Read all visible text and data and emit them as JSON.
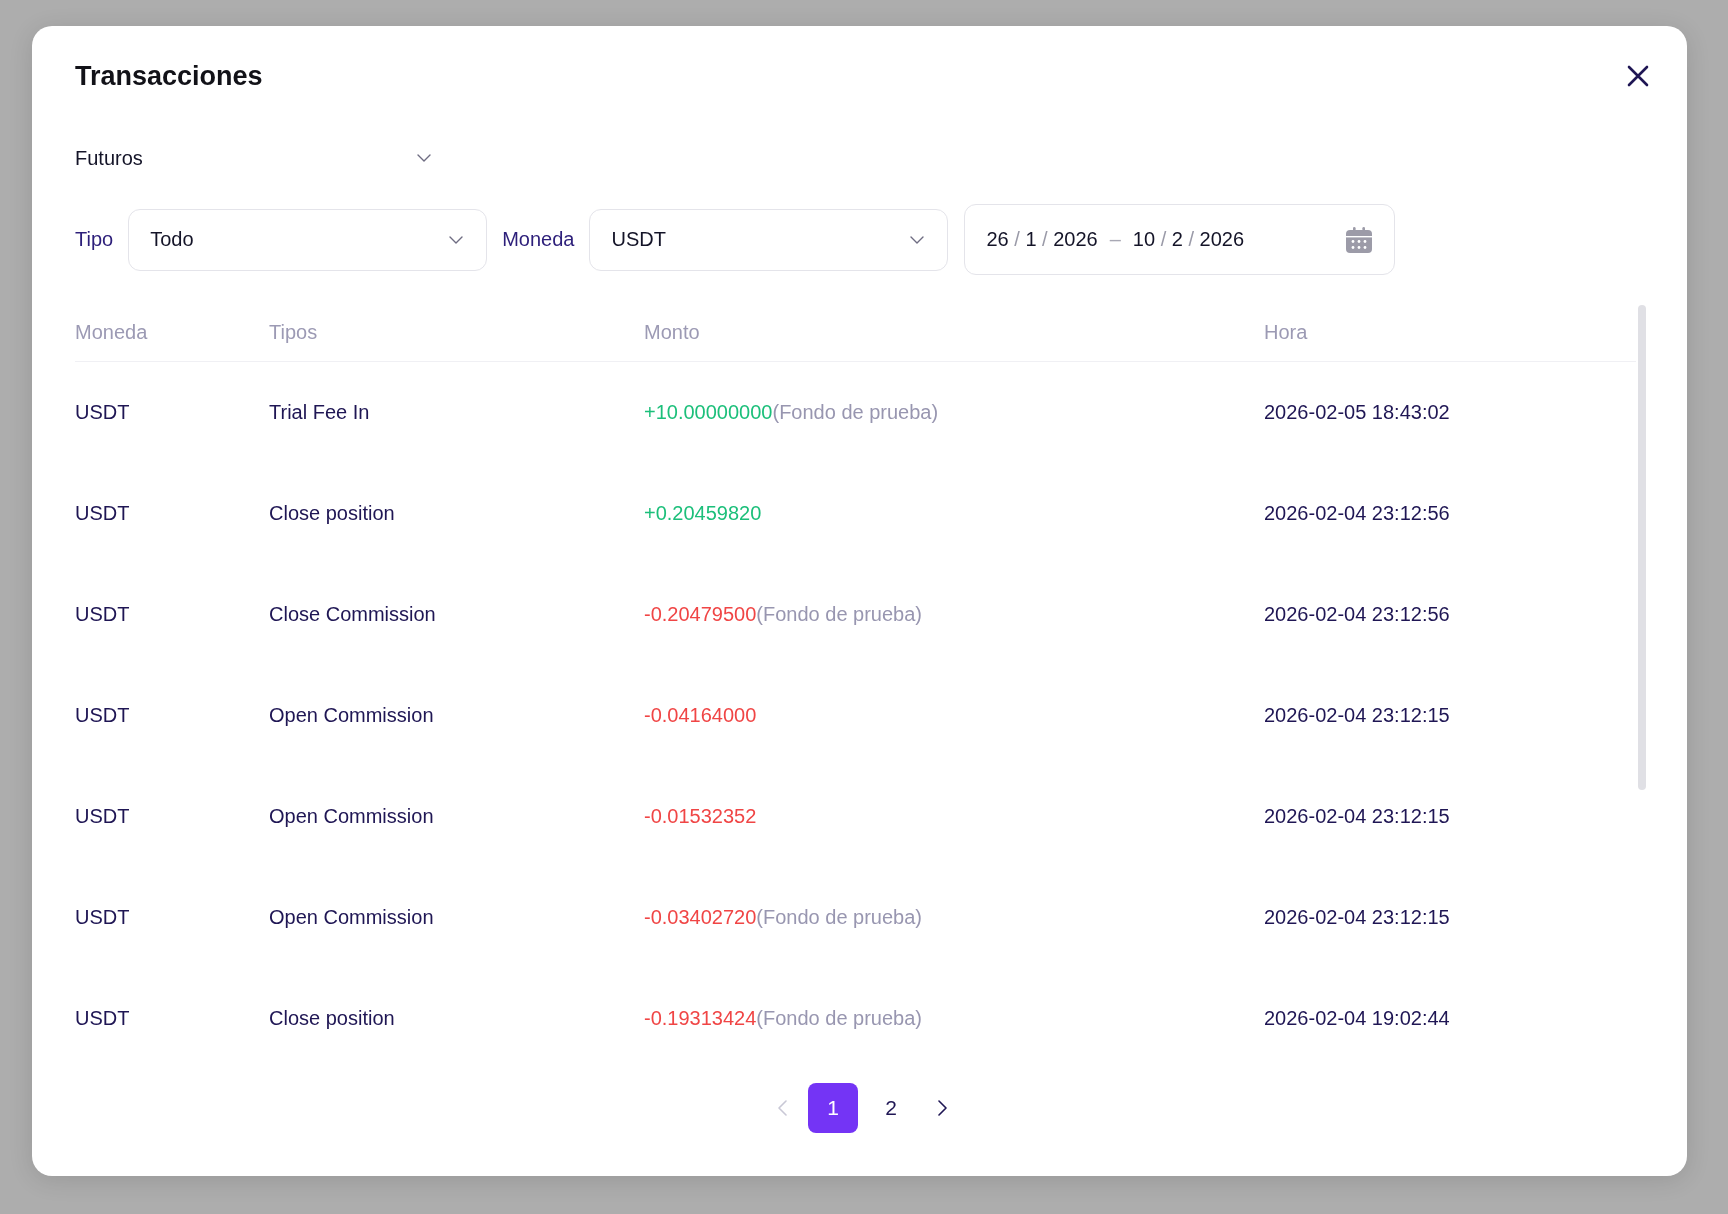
{
  "dialog": {
    "title": "Transacciones"
  },
  "market_select": {
    "value": "Futuros"
  },
  "filters": [
    {
      "label": "Tipo",
      "value": "Todo"
    },
    {
      "label": "Moneda",
      "value": "USDT"
    }
  ],
  "date_range": {
    "start": [
      {
        "text": "26",
        "kind": "value"
      },
      {
        "text": "/",
        "kind": "slash"
      },
      {
        "text": "1",
        "kind": "value"
      },
      {
        "text": "/",
        "kind": "slash"
      },
      {
        "text": "2026",
        "kind": "value"
      }
    ],
    "separator": "–",
    "end": [
      {
        "text": "10",
        "kind": "value"
      },
      {
        "text": "/",
        "kind": "slash"
      },
      {
        "text": "2",
        "kind": "value"
      },
      {
        "text": "/",
        "kind": "slash"
      },
      {
        "text": "2026",
        "kind": "value"
      }
    ]
  },
  "table": {
    "columns": [
      "Moneda",
      "Tipos",
      "Monto",
      "Hora"
    ],
    "rows": [
      {
        "currency": "USDT",
        "type": "Trial Fee In",
        "amount": "+10.00000000",
        "kind": "credit",
        "note": "(Fondo de prueba)",
        "time": "2026-02-05 18:43:02"
      },
      {
        "currency": "USDT",
        "type": "Close position",
        "amount": "+0.20459820",
        "kind": "credit",
        "time": "2026-02-04 23:12:56"
      },
      {
        "currency": "USDT",
        "type": "Close Commission",
        "amount": "-0.20479500",
        "kind": "debit",
        "note": "(Fondo de prueba)",
        "time": "2026-02-04 23:12:56"
      },
      {
        "currency": "USDT",
        "type": "Open Commission",
        "amount": "-0.04164000",
        "kind": "debit",
        "time": "2026-02-04 23:12:15"
      },
      {
        "currency": "USDT",
        "type": "Open Commission",
        "amount": "-0.01532352",
        "kind": "debit",
        "time": "2026-02-04 23:12:15"
      },
      {
        "currency": "USDT",
        "type": "Open Commission",
        "amount": "-0.03402720",
        "kind": "debit",
        "note": "(Fondo de prueba)",
        "time": "2026-02-04 23:12:15"
      },
      {
        "currency": "USDT",
        "type": "Close position",
        "amount": "-0.19313424",
        "kind": "debit",
        "note": "(Fondo de prueba)",
        "time": "2026-02-04 19:02:44"
      }
    ]
  },
  "pagination": {
    "previous": {
      "disabled": true
    },
    "pages": [
      {
        "label": "1",
        "selected": true
      },
      {
        "label": "2",
        "selected": false
      }
    ],
    "next": {
      "disabled": false
    }
  }
}
